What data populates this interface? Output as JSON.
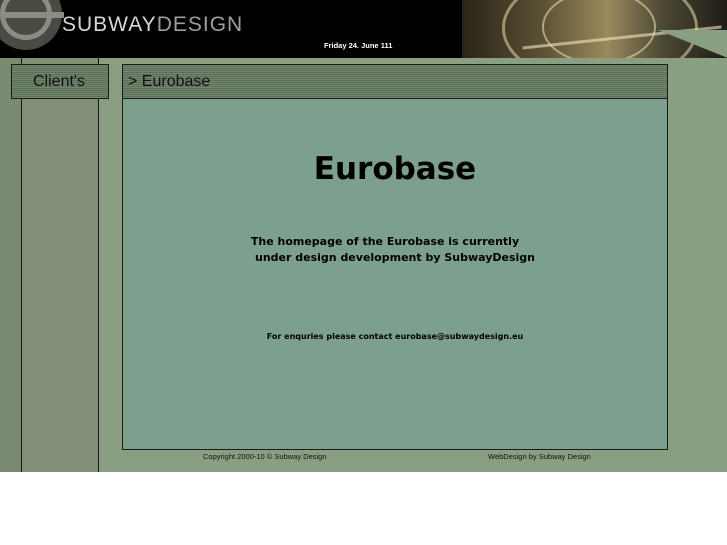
{
  "header": {
    "logo_primary": "SUBWAY",
    "logo_secondary": "DESIGN",
    "date": "Friday 24. June 111"
  },
  "nav": {
    "clients_label": "Client's"
  },
  "section": {
    "title": "> Eurobase"
  },
  "content": {
    "heading": "Eurobase",
    "message_line1": "The homepage of the Eurobase is currently",
    "message_line2": "under design development by SubwayDesign",
    "contact_prefix": "For enquries please contact",
    "contact_email": "eurobase@subwaydesign.eu"
  },
  "footer": {
    "copyright": "Copyright 2000-10 © Subway Design",
    "credit": "WebDesign by Subway Design"
  },
  "colors": {
    "page_bg": "#8a9e82",
    "content_bg": "#7d9f8e",
    "header_bg": "#000000"
  }
}
